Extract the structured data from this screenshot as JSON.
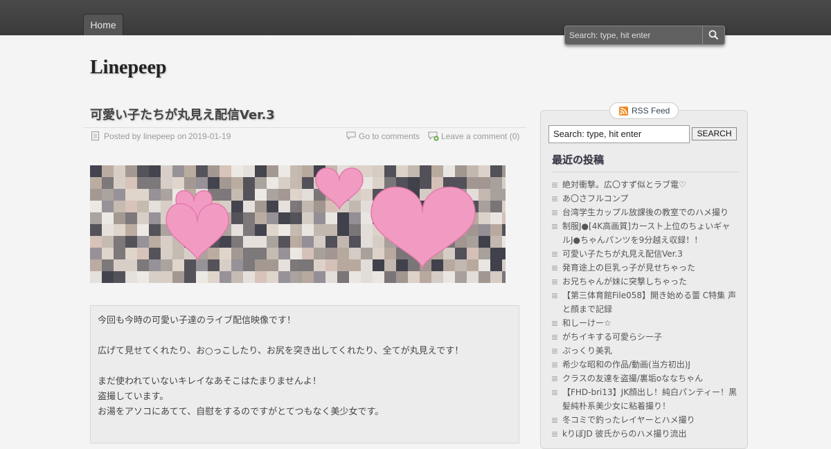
{
  "nav": {
    "home": "Home"
  },
  "top_search": {
    "placeholder": "Search: type, hit enter"
  },
  "site": {
    "title": "Linepeep"
  },
  "post": {
    "title": "可愛い子たちが丸見え配信Ver.3",
    "posted_prefix": "Posted by",
    "author": "linepeep",
    "on": "on",
    "date": "2019-01-19",
    "comments_link": "Go to comments",
    "leave_comment": "Leave a comment (0)",
    "paragraphs": [
      "今回も今時の可愛い子達のライブ配信映像です！",
      "広げて見せてくれたり、お○っこしたり、お尻を突き出してくれたり、全てが丸見えです！",
      "まだ使われていないキレイなあそこはたまりませんよ！",
      "盗撮しています。",
      "お湯をアソコにあてて、自慰をするのですがとてつもなく美少女です。"
    ]
  },
  "sidebar": {
    "rss_label": "RSS Feed",
    "search_value": "Search: type, hit enter",
    "search_button": "SEARCH",
    "widget_title": "最近の投稿",
    "recent_posts": [
      "絶対衝撃。広〇すず似とラブ電♡",
      "あ〇さフルコンプ",
      "台湾学生カップル放課後の教室でのハメ撮り",
      "制服J●[4K高画質]カースト上位のちょいギャルJ●ちゃんパンツを9分越え収録！！",
      "可愛い子たちが丸見え配信Ver.3",
      "発育途上の巨乳っ子が見せちゃった",
      "お兄ちゃんが妹に突撃しちゃった",
      "【第三体育館File058】開き始める蕾 C特集 声と顔まで記録",
      "和しーけー☆",
      "がちイキする可愛らシー子",
      "ぷっくり美乳",
      "希少な昭和の作品/動画(当方初出)J",
      "クラスの友達を盗撮/裏垢oななちゃん",
      "【FHD-bri13】JK顔出し！純白パンティー！黒髪純朴系美少女に粘着撮り！",
      "冬コミで釣ったレイヤーとハメ撮り",
      "kりぼJD 彼氏からのハメ撮り流出"
    ]
  },
  "colors": {
    "topbar": "#3f3f3f",
    "page_bg": "#f4f4f4",
    "heart": "#f29bc2"
  },
  "icons": [
    "search-icon",
    "document-icon",
    "comment-icon",
    "add-comment-icon",
    "rss-icon"
  ]
}
